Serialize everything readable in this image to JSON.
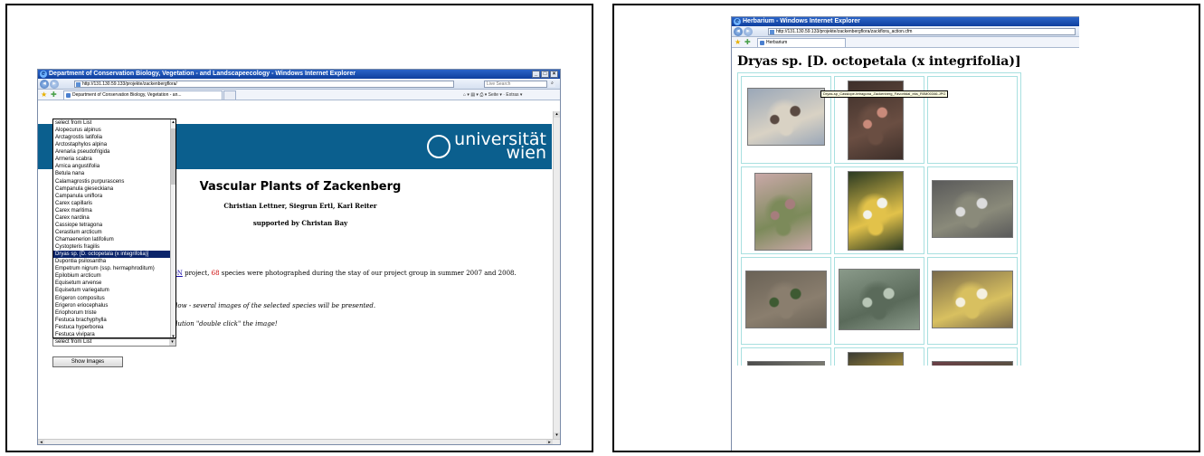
{
  "left_window": {
    "title": "Department of Conservation Biology, Vegetation - and Landscapeecology - Windows Internet Explorer",
    "address": "http://131.130.59.133/projekte/zackenbergflora/",
    "search_placeholder": "Live Search",
    "tab_label": "Department of Conservation Biology, Vegetation - an...",
    "tools_label": "Seite ▾ · Extras ▾",
    "page": {
      "logo_text_line1": "universität",
      "logo_text_line2": "wien",
      "title": "Vascular Plants of Zackenberg",
      "authors": "Christian Lettner, Siegrun Ertl, Karl Reiter",
      "supported_by": "supported by Christan Bay",
      "para_link": "ON",
      "para_text_1": " project, ",
      "para_count": "68",
      "para_text_2": " species were photographed during the stay of our project group in summer 2007 and 2008.",
      "hint_1": "elow - several images of the selected species will be presented.",
      "hint_2": "olution \"double click\" the image!",
      "select_value": "select from List",
      "show_button": "Show Images",
      "species_options": [
        "select from List",
        "Alopecurus alpinus",
        "Arctagrostis latifolia",
        "Arctostaphylos alpina",
        "Arenaria pseudofrigida",
        "Armeria scabra",
        "Arnica angustifolia",
        "Betula nana",
        "Calamagrostis purpurascens",
        "Campanula gieseckiana",
        "Campanula uniflora",
        "Carex capillaris",
        "Carex maritima",
        "Carex nardina",
        "Cassiope tetragona",
        "Cerastium arcticum",
        "Chamaenerion latifolium",
        "Cystopteris fragilis",
        "Dryas sp. [D. octopetala (x integrifolia)]",
        "Dupontia psilosantha",
        "Empetrum nigrum (ssp. hermaphroditum)",
        "Epilobium arcticum",
        "Equisetum arvense",
        "Equisetum variegatum",
        "Erigeron compositus",
        "Erigeron eriocephalus",
        "Eriophorum triste",
        "Festuca brachyphylla",
        "Festuca hyperborea",
        "Festuca vivipara"
      ],
      "selected_option": "Dryas sp. [D. octopetala (x integrifolia)]"
    }
  },
  "right_window": {
    "title": "Herbarium - Windows Internet Explorer",
    "address": "http://131.130.59.133/projekte/zackenbergflora/zackflora_action.cfm",
    "tab_label": "Herbarium",
    "species_title": "Dryas sp. [D. octopetala (x integrifolia)]",
    "tooltip": "Dryas-sp_Cassiope-tetragona_Zackenberg_Favoritdal_eks_R0M00346.JPG",
    "photos": [
      {
        "icon": "landscape-photo-icon",
        "colors": [
          "#9aa7b8",
          "#5a4a42",
          "#d9d2c4"
        ]
      },
      {
        "icon": "flower-bud-photo-icon",
        "colors": [
          "#3d2f2a",
          "#c98a7a",
          "#6a4e42"
        ]
      },
      {
        "icon": "empty-cell",
        "colors": []
      },
      {
        "icon": "seedhead-photo-icon",
        "colors": [
          "#c9a8a8",
          "#a67d7d",
          "#7c8a5a"
        ]
      },
      {
        "icon": "white-flower-photo-icon",
        "colors": [
          "#2b3a22",
          "#f2f2ea",
          "#e2c24a"
        ]
      },
      {
        "icon": "cushion-flowers-photo-icon",
        "colors": [
          "#5a5a5a",
          "#dcdcdc",
          "#8a8a7a"
        ]
      },
      {
        "icon": "leaves-photo-icon",
        "colors": [
          "#6a6256",
          "#3e5a32",
          "#8a7e6e"
        ]
      },
      {
        "icon": "succulent-leaves-photo-icon",
        "colors": [
          "#8a9a8a",
          "#b8c6b6",
          "#5a6a5a"
        ]
      },
      {
        "icon": "flowers-cluster-photo-icon",
        "colors": [
          "#7a6a4a",
          "#f4f0e0",
          "#d8c060"
        ]
      },
      {
        "icon": "cushion-flowers-gray-photo-icon",
        "colors": [
          "#4a4a4a",
          "#e6e6e6",
          "#9a9a8a"
        ]
      },
      {
        "icon": "white-flower-closeup-photo-icon",
        "colors": [
          "#3a3a32",
          "#f6f6f0",
          "#e8c040"
        ]
      },
      {
        "icon": "reddish-foliage-photo-icon",
        "colors": [
          "#6a3e46",
          "#8e5a60",
          "#4e5a3e"
        ]
      }
    ]
  }
}
